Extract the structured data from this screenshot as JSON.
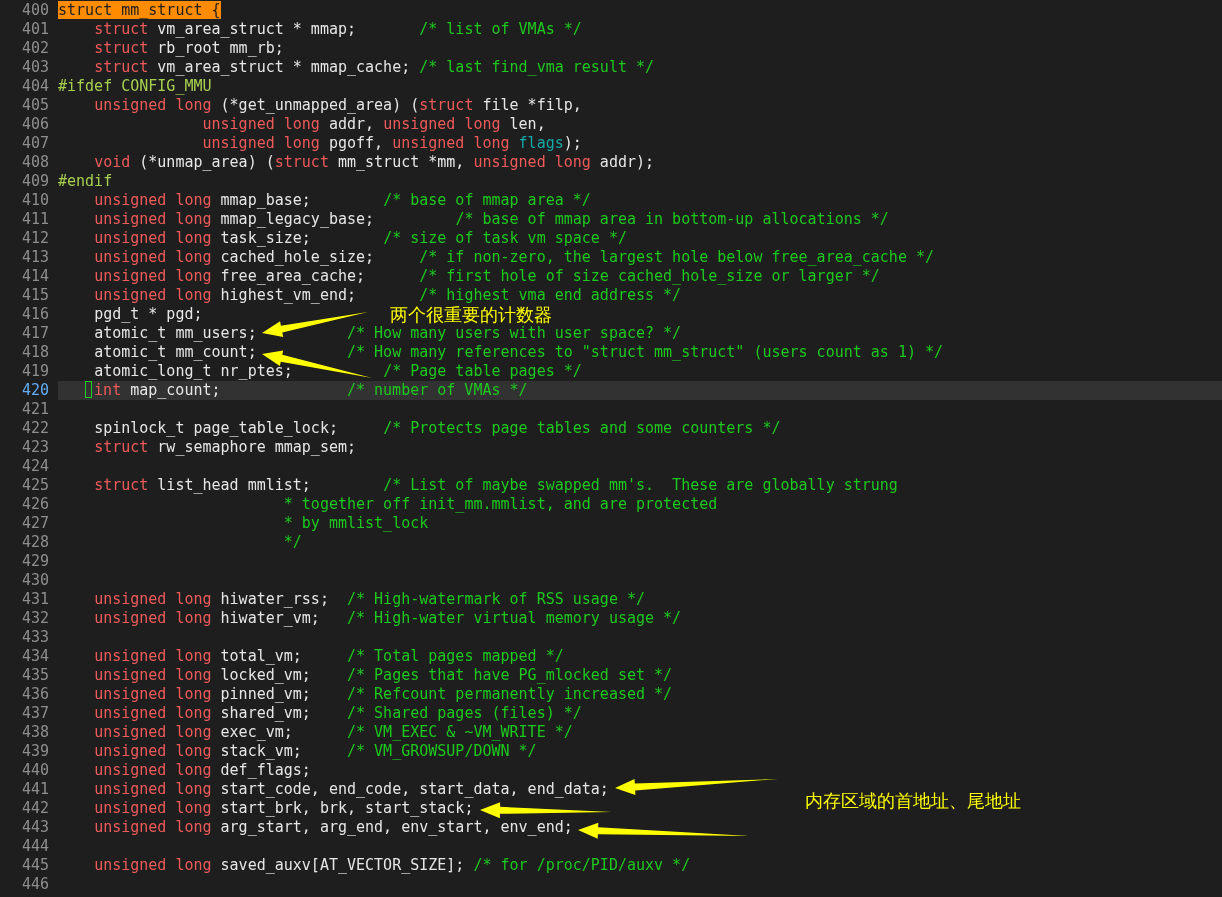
{
  "lines": [
    {
      "number": "400",
      "current": false,
      "segments": [
        {
          "kind": "match",
          "text": "struct mm_struct {"
        }
      ]
    },
    {
      "number": "401",
      "current": false,
      "segments": [
        {
          "kind": "kw",
          "text": "    struct"
        },
        {
          "kind": "text",
          "text": " vm_area_struct * mmap;       "
        },
        {
          "kind": "comment",
          "text": "/* list of VMAs */"
        }
      ]
    },
    {
      "number": "402",
      "current": false,
      "segments": [
        {
          "kind": "kw",
          "text": "    struct"
        },
        {
          "kind": "text",
          "text": " rb_root mm_rb;"
        }
      ]
    },
    {
      "number": "403",
      "current": false,
      "segments": [
        {
          "kind": "kw",
          "text": "    struct"
        },
        {
          "kind": "text",
          "text": " vm_area_struct * mmap_cache; "
        },
        {
          "kind": "comment",
          "text": "/* last find_vma result */"
        }
      ]
    },
    {
      "number": "404",
      "current": false,
      "segments": [
        {
          "kind": "pre",
          "text": "#ifdef CONFIG_MMU"
        }
      ]
    },
    {
      "number": "405",
      "current": false,
      "segments": [
        {
          "kind": "kw",
          "text": "    unsigned long"
        },
        {
          "kind": "text",
          "text": " (*get_unmapped_area) ("
        },
        {
          "kind": "kw",
          "text": "struct"
        },
        {
          "kind": "text",
          "text": " file *filp,"
        }
      ]
    },
    {
      "number": "406",
      "current": false,
      "segments": [
        {
          "kind": "kw",
          "text": "                unsigned long"
        },
        {
          "kind": "text",
          "text": " addr, "
        },
        {
          "kind": "kw",
          "text": "unsigned long"
        },
        {
          "kind": "text",
          "text": " len,"
        }
      ]
    },
    {
      "number": "407",
      "current": false,
      "segments": [
        {
          "kind": "kw",
          "text": "                unsigned long"
        },
        {
          "kind": "text",
          "text": " pgoff, "
        },
        {
          "kind": "kw",
          "text": "unsigned long "
        },
        {
          "kind": "param",
          "text": "flags"
        },
        {
          "kind": "text",
          "text": ");"
        }
      ]
    },
    {
      "number": "408",
      "current": false,
      "segments": [
        {
          "kind": "kw",
          "text": "    void"
        },
        {
          "kind": "text",
          "text": " (*unmap_area) ("
        },
        {
          "kind": "kw",
          "text": "struct"
        },
        {
          "kind": "text",
          "text": " mm_struct *mm, "
        },
        {
          "kind": "kw",
          "text": "unsigned long"
        },
        {
          "kind": "text",
          "text": " addr);"
        }
      ]
    },
    {
      "number": "409",
      "current": false,
      "segments": [
        {
          "kind": "pre",
          "text": "#endif"
        }
      ]
    },
    {
      "number": "410",
      "current": false,
      "segments": [
        {
          "kind": "kw",
          "text": "    unsigned long"
        },
        {
          "kind": "text",
          "text": " mmap_base;        "
        },
        {
          "kind": "comment",
          "text": "/* base of mmap area */"
        }
      ]
    },
    {
      "number": "411",
      "current": false,
      "segments": [
        {
          "kind": "kw",
          "text": "    unsigned long"
        },
        {
          "kind": "text",
          "text": " mmap_legacy_base;         "
        },
        {
          "kind": "comment",
          "text": "/* base of mmap area in bottom-up allocations */"
        }
      ]
    },
    {
      "number": "412",
      "current": false,
      "segments": [
        {
          "kind": "kw",
          "text": "    unsigned long"
        },
        {
          "kind": "text",
          "text": " task_size;        "
        },
        {
          "kind": "comment",
          "text": "/* size of task vm space */"
        }
      ]
    },
    {
      "number": "413",
      "current": false,
      "segments": [
        {
          "kind": "kw",
          "text": "    unsigned long"
        },
        {
          "kind": "text",
          "text": " cached_hole_size;     "
        },
        {
          "kind": "comment",
          "text": "/* if non-zero, the largest hole below free_area_cache */"
        }
      ]
    },
    {
      "number": "414",
      "current": false,
      "segments": [
        {
          "kind": "kw",
          "text": "    unsigned long"
        },
        {
          "kind": "text",
          "text": " free_area_cache;      "
        },
        {
          "kind": "comment",
          "text": "/* first hole of size cached_hole_size or larger */"
        }
      ]
    },
    {
      "number": "415",
      "current": false,
      "segments": [
        {
          "kind": "kw",
          "text": "    unsigned long"
        },
        {
          "kind": "text",
          "text": " highest_vm_end;       "
        },
        {
          "kind": "comment",
          "text": "/* highest vma end address */"
        }
      ]
    },
    {
      "number": "416",
      "current": false,
      "segments": [
        {
          "kind": "text",
          "text": "    pgd_t * pgd;"
        }
      ]
    },
    {
      "number": "417",
      "current": false,
      "segments": [
        {
          "kind": "text",
          "text": "    atomic_t mm_users;          "
        },
        {
          "kind": "comment",
          "text": "/* How many users with user space? */"
        }
      ]
    },
    {
      "number": "418",
      "current": false,
      "segments": [
        {
          "kind": "text",
          "text": "    atomic_t mm_count;          "
        },
        {
          "kind": "comment",
          "text": "/* How many references to \"struct mm_struct\" (users count as 1) */"
        }
      ]
    },
    {
      "number": "419",
      "current": false,
      "segments": [
        {
          "kind": "text",
          "text": "    atomic_long_t nr_ptes;          "
        },
        {
          "kind": "comment",
          "text": "/* Page table pages */"
        }
      ]
    },
    {
      "number": "420",
      "current": true,
      "segments": [
        {
          "kind": "cursor"
        },
        {
          "kind": "kw",
          "text": "int"
        },
        {
          "kind": "text",
          "text": " map_count;              "
        },
        {
          "kind": "comment",
          "text": "/* number of VMAs */"
        }
      ]
    },
    {
      "number": "421",
      "current": false
    },
    {
      "number": "422",
      "current": false,
      "segments": [
        {
          "kind": "text",
          "text": "    spinlock_t page_table_lock;     "
        },
        {
          "kind": "comment",
          "text": "/* Protects page tables and some counters */"
        }
      ]
    },
    {
      "number": "423",
      "current": false,
      "segments": [
        {
          "kind": "kw",
          "text": "    struct"
        },
        {
          "kind": "text",
          "text": " rw_semaphore mmap_sem;"
        }
      ]
    },
    {
      "number": "424",
      "current": false
    },
    {
      "number": "425",
      "current": false,
      "segments": [
        {
          "kind": "kw",
          "text": "    struct"
        },
        {
          "kind": "text",
          "text": " list_head mmlist;        "
        },
        {
          "kind": "comment",
          "text": "/* List of maybe swapped mm's.  These are globally strung"
        }
      ]
    },
    {
      "number": "426",
      "current": false,
      "segments": [
        {
          "kind": "comment",
          "text": "                         * together off init_mm.mmlist, and are protected"
        }
      ]
    },
    {
      "number": "427",
      "current": false,
      "segments": [
        {
          "kind": "comment",
          "text": "                         * by mmlist_lock"
        }
      ]
    },
    {
      "number": "428",
      "current": false,
      "segments": [
        {
          "kind": "comment",
          "text": "                         */"
        }
      ]
    },
    {
      "number": "429",
      "current": false
    },
    {
      "number": "430",
      "current": false
    },
    {
      "number": "431",
      "current": false,
      "segments": [
        {
          "kind": "kw",
          "text": "    unsigned long"
        },
        {
          "kind": "text",
          "text": " hiwater_rss;  "
        },
        {
          "kind": "comment",
          "text": "/* High-watermark of RSS usage */"
        }
      ]
    },
    {
      "number": "432",
      "current": false,
      "segments": [
        {
          "kind": "kw",
          "text": "    unsigned long"
        },
        {
          "kind": "text",
          "text": " hiwater_vm;   "
        },
        {
          "kind": "comment",
          "text": "/* High-water virtual memory usage */"
        }
      ]
    },
    {
      "number": "433",
      "current": false
    },
    {
      "number": "434",
      "current": false,
      "segments": [
        {
          "kind": "kw",
          "text": "    unsigned long"
        },
        {
          "kind": "text",
          "text": " total_vm;     "
        },
        {
          "kind": "comment",
          "text": "/* Total pages mapped */"
        }
      ]
    },
    {
      "number": "435",
      "current": false,
      "segments": [
        {
          "kind": "kw",
          "text": "    unsigned long"
        },
        {
          "kind": "text",
          "text": " locked_vm;    "
        },
        {
          "kind": "comment",
          "text": "/* Pages that have PG_mlocked set */"
        }
      ]
    },
    {
      "number": "436",
      "current": false,
      "segments": [
        {
          "kind": "kw",
          "text": "    unsigned long"
        },
        {
          "kind": "text",
          "text": " pinned_vm;    "
        },
        {
          "kind": "comment",
          "text": "/* Refcount permanently increased */"
        }
      ]
    },
    {
      "number": "437",
      "current": false,
      "segments": [
        {
          "kind": "kw",
          "text": "    unsigned long"
        },
        {
          "kind": "text",
          "text": " shared_vm;    "
        },
        {
          "kind": "comment",
          "text": "/* Shared pages (files) */"
        }
      ]
    },
    {
      "number": "438",
      "current": false,
      "segments": [
        {
          "kind": "kw",
          "text": "    unsigned long"
        },
        {
          "kind": "text",
          "text": " exec_vm;      "
        },
        {
          "kind": "comment",
          "text": "/* VM_EXEC & ~VM_WRITE */"
        }
      ]
    },
    {
      "number": "439",
      "current": false,
      "segments": [
        {
          "kind": "kw",
          "text": "    unsigned long"
        },
        {
          "kind": "text",
          "text": " stack_vm;     "
        },
        {
          "kind": "comment",
          "text": "/* VM_GROWSUP/DOWN */"
        }
      ]
    },
    {
      "number": "440",
      "current": false,
      "segments": [
        {
          "kind": "kw",
          "text": "    unsigned long"
        },
        {
          "kind": "text",
          "text": " def_flags;"
        }
      ]
    },
    {
      "number": "441",
      "current": false,
      "segments": [
        {
          "kind": "kw",
          "text": "    unsigned long"
        },
        {
          "kind": "text",
          "text": " start_code, end_code, start_data, end_data;"
        }
      ]
    },
    {
      "number": "442",
      "current": false,
      "segments": [
        {
          "kind": "kw",
          "text": "    unsigned long"
        },
        {
          "kind": "text",
          "text": " start_brk, brk, start_stack;"
        }
      ]
    },
    {
      "number": "443",
      "current": false,
      "segments": [
        {
          "kind": "kw",
          "text": "    unsigned long"
        },
        {
          "kind": "text",
          "text": " arg_start, arg_end, env_start, env_end;"
        }
      ]
    },
    {
      "number": "444",
      "current": false
    },
    {
      "number": "445",
      "current": false,
      "segments": [
        {
          "kind": "kw",
          "text": "    unsigned long"
        },
        {
          "kind": "text",
          "text": " saved_auxv[AT_VECTOR_SIZE]; "
        },
        {
          "kind": "comment",
          "text": "/* for /proc/PID/auxv */"
        }
      ]
    },
    {
      "number": "446",
      "current": false
    }
  ],
  "annotations": [
    {
      "text": "两个很重要的计数器"
    },
    {
      "text": "内存区域的首地址、尾地址"
    }
  ]
}
